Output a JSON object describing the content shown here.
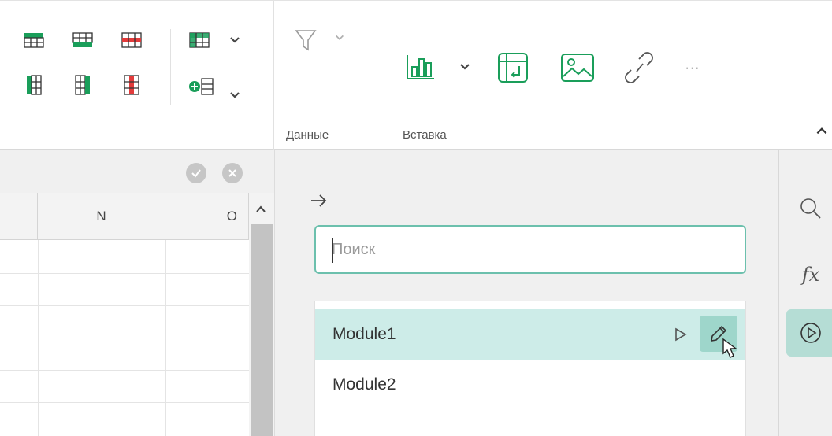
{
  "ribbon": {
    "groups": {
      "data_label": "Данные",
      "insert_label": "Вставка"
    },
    "collapse_icon": "chevron-up-icon",
    "more_label": "···"
  },
  "grid": {
    "columns": [
      "N",
      "O"
    ]
  },
  "macro_panel": {
    "back_icon": "arrow-right-icon",
    "search_placeholder": "Поиск",
    "search_value": "",
    "modules": [
      {
        "label": "Module1",
        "selected": true
      },
      {
        "label": "Module2",
        "selected": false
      }
    ]
  },
  "sidebar": {
    "items": [
      {
        "icon": "search-icon",
        "active": false
      },
      {
        "icon": "function-fx-icon",
        "label": "fx",
        "active": false
      },
      {
        "icon": "play-macro-icon",
        "active": true
      }
    ]
  },
  "colors": {
    "accent": "#1a9e5a",
    "teal_border": "#6cc0ad",
    "selection": "#cdece8",
    "active_tab": "#b5ddd5",
    "red_cells": "#e23b3b"
  }
}
